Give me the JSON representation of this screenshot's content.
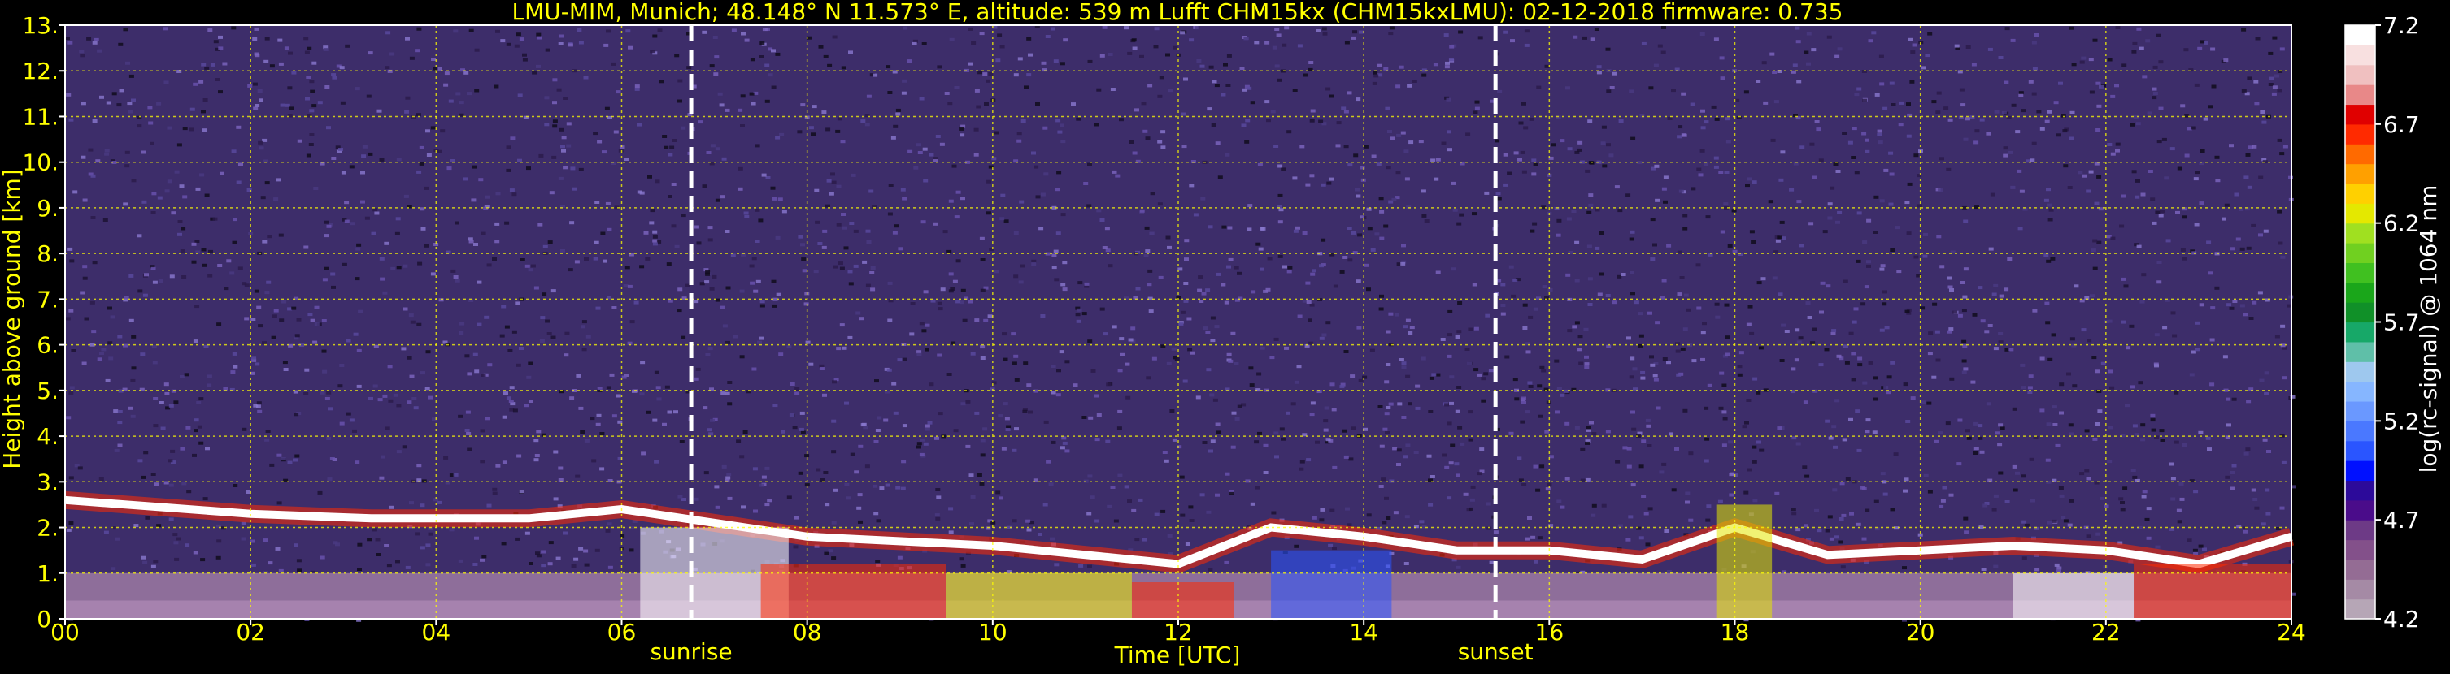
{
  "chart_data": {
    "type": "heatmap",
    "title": "LMU-MIM, Munich; 48.148° N 11.573° E, altitude: 539 m    Lufft CHM15kx (CHM15kxLMU): 02-12-2018    firmware: 0.735",
    "xlabel": "Time [UTC]",
    "ylabel": "Height above ground [km]",
    "xlim": [
      0,
      24
    ],
    "ylim": [
      0,
      13
    ],
    "x_ticks": [
      "00",
      "02",
      "04",
      "06",
      "08",
      "10",
      "12",
      "14",
      "16",
      "18",
      "20",
      "22",
      "24"
    ],
    "x_tick_values": [
      0,
      2,
      4,
      6,
      8,
      10,
      12,
      14,
      16,
      18,
      20,
      22,
      24
    ],
    "y_ticks": [
      "0.",
      "1.",
      "2.",
      "3.",
      "4.",
      "5.",
      "6.",
      "7.",
      "8.",
      "9.",
      "10.",
      "11.",
      "12.",
      "13."
    ],
    "y_tick_values": [
      0,
      1,
      2,
      3,
      4,
      5,
      6,
      7,
      8,
      9,
      10,
      11,
      12,
      13
    ],
    "grid": true,
    "grid_color": "#ffff00",
    "text_color": "#ffff00",
    "background": "#000000",
    "annotations": [
      {
        "label": "sunrise",
        "x": 6.75
      },
      {
        "label": "sunset",
        "x": 15.42
      }
    ],
    "colorbar": {
      "label": "log(rc-signal) @ 1064 nm",
      "range": [
        4.2,
        7.2
      ],
      "ticks": [
        "4.2",
        "4.7",
        "5.2",
        "5.7",
        "6.2",
        "6.7",
        "7.2"
      ],
      "tick_values": [
        4.2,
        4.7,
        5.2,
        5.7,
        6.2,
        6.7,
        7.2
      ],
      "colors": [
        "#b6a6b6",
        "#a58aa5",
        "#946c94",
        "#83508a",
        "#6d3a86",
        "#4a0c8a",
        "#2c0a9a",
        "#0010ff",
        "#2a55ff",
        "#4a78ff",
        "#6a98ff",
        "#86b6ff",
        "#9ec8ee",
        "#5fbfa8",
        "#17a868",
        "#109028",
        "#1aa61a",
        "#40c020",
        "#70d020",
        "#a0e020",
        "#e4e800",
        "#ffd000",
        "#ffa000",
        "#ff6a00",
        "#ff2a00",
        "#e00000",
        "#e88888",
        "#f0c0c0",
        "#f8e0e0",
        "#ffffff"
      ]
    },
    "layers": [
      {
        "name": "surface layer",
        "t_range": [
          0,
          24
        ],
        "height_range_km": [
          0,
          1.0
        ]
      },
      {
        "name": "aerosol layer top",
        "times": [
          0,
          2,
          3.3,
          5,
          6,
          8,
          10,
          12,
          13,
          14,
          15,
          16,
          17,
          18,
          19,
          20,
          21,
          22,
          23,
          24
        ],
        "heights_km": [
          2.6,
          2.3,
          2.2,
          2.2,
          2.4,
          1.8,
          1.6,
          1.2,
          2.0,
          1.8,
          1.5,
          1.5,
          1.3,
          2.0,
          1.4,
          1.5,
          1.6,
          1.5,
          1.2,
          1.8
        ]
      }
    ]
  }
}
